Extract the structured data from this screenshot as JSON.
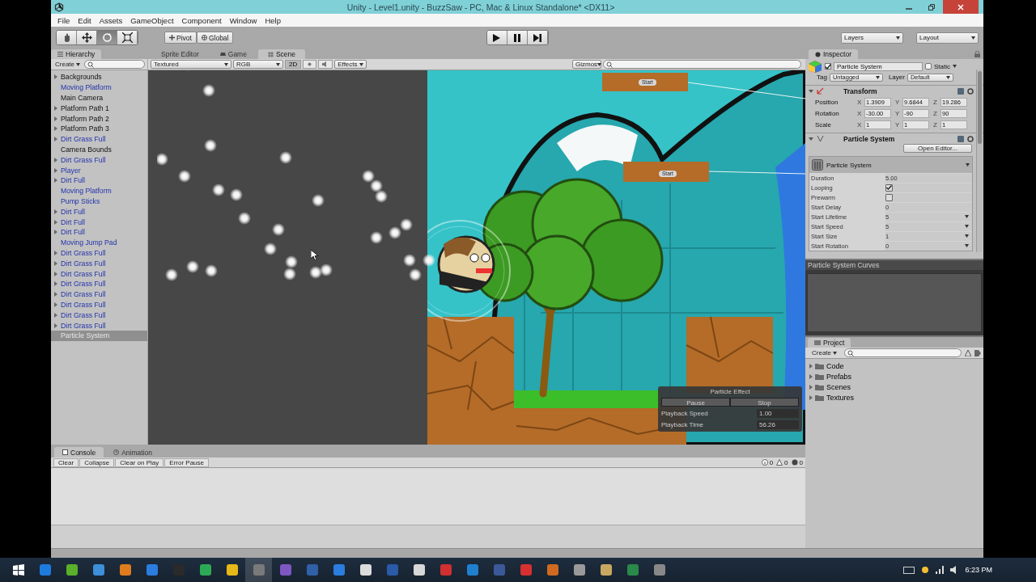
{
  "window": {
    "title": "Unity - Level1.unity - BuzzSaw - PC, Mac & Linux Standalone* <DX11>",
    "menu": [
      "File",
      "Edit",
      "Assets",
      "GameObject",
      "Component",
      "Window",
      "Help"
    ]
  },
  "toolbar": {
    "tools": [
      {
        "kind": "hand",
        "selected": false
      },
      {
        "kind": "move",
        "selected": false
      },
      {
        "kind": "rotate",
        "selected": true
      },
      {
        "kind": "scale",
        "selected": false
      }
    ],
    "pivot": "Pivot",
    "space": "Global",
    "layers": "Layers",
    "layout": "Layout"
  },
  "hierarchy": {
    "tab": "Hierarchy",
    "create": "Create",
    "items": [
      {
        "label": "Backgrounds",
        "expandable": true,
        "prefab": false,
        "selected": false
      },
      {
        "label": "Moving Platform",
        "expandable": false,
        "prefab": true,
        "selected": false
      },
      {
        "label": "Main Camera",
        "expandable": false,
        "prefab": false,
        "selected": false
      },
      {
        "label": "Platform Path 1",
        "expandable": true,
        "prefab": false,
        "selected": false
      },
      {
        "label": "Platform Path 2",
        "expandable": true,
        "prefab": false,
        "selected": false
      },
      {
        "label": "Platform Path 3",
        "expandable": true,
        "prefab": false,
        "selected": false
      },
      {
        "label": "Dirt Grass Full",
        "expandable": true,
        "prefab": true,
        "selected": false
      },
      {
        "label": "Camera Bounds",
        "expandable": false,
        "prefab": false,
        "selected": false
      },
      {
        "label": "Dirt Grass Full",
        "expandable": true,
        "prefab": true,
        "selected": false
      },
      {
        "label": "Player",
        "expandable": true,
        "prefab": true,
        "selected": false
      },
      {
        "label": "Dirt Full",
        "expandable": true,
        "prefab": true,
        "selected": false
      },
      {
        "label": "Moving Platform",
        "expandable": false,
        "prefab": true,
        "selected": false
      },
      {
        "label": "Pump Sticks",
        "expandable": false,
        "prefab": true,
        "selected": false
      },
      {
        "label": "Dirt Full",
        "expandable": true,
        "prefab": true,
        "selected": false
      },
      {
        "label": "Dirt Full",
        "expandable": true,
        "prefab": true,
        "selected": false
      },
      {
        "label": "Dirt Full",
        "expandable": true,
        "prefab": true,
        "selected": false
      },
      {
        "label": "Moving Jump Pad",
        "expandable": false,
        "prefab": true,
        "selected": false
      },
      {
        "label": "Dirt Grass Full",
        "expandable": true,
        "prefab": true,
        "selected": false
      },
      {
        "label": "Dirt Grass Full",
        "expandable": true,
        "prefab": true,
        "selected": false
      },
      {
        "label": "Dirt Grass Full",
        "expandable": true,
        "prefab": true,
        "selected": false
      },
      {
        "label": "Dirt Grass Full",
        "expandable": true,
        "prefab": true,
        "selected": false
      },
      {
        "label": "Dirt Grass Full",
        "expandable": true,
        "prefab": true,
        "selected": false
      },
      {
        "label": "Dirt Grass Full",
        "expandable": true,
        "prefab": true,
        "selected": false
      },
      {
        "label": "Dirt Grass Full",
        "expandable": true,
        "prefab": true,
        "selected": false
      },
      {
        "label": "Dirt Grass Full",
        "expandable": true,
        "prefab": true,
        "selected": false
      },
      {
        "label": "Particle System",
        "expandable": false,
        "prefab": false,
        "selected": true
      }
    ]
  },
  "scene_tabs": [
    {
      "label": "Sprite Editor",
      "selected": false
    },
    {
      "label": "Game",
      "selected": false
    },
    {
      "label": "Scene",
      "selected": true
    }
  ],
  "scene_toolbar": {
    "shading": "Textured",
    "channel": "RGB",
    "mode_2d": {
      "label": "2D",
      "on": true
    },
    "lighting": {
      "on": false
    },
    "audio": {
      "on": false
    },
    "effects": "Effects",
    "gizmos": "Gizmos"
  },
  "scene": {
    "platform_labels": [
      "Start",
      "Start"
    ],
    "particle_effect": {
      "title": "Particle Effect",
      "buttons": [
        "Pause",
        "Stop"
      ],
      "rows": [
        {
          "label": "Playback Speed",
          "value": "1.00"
        },
        {
          "label": "Playback Time",
          "value": "56.26"
        }
      ]
    }
  },
  "console": {
    "tabs": [
      {
        "label": "Console",
        "selected": true
      },
      {
        "label": "Animation",
        "selected": false
      }
    ],
    "buttons": [
      "Clear",
      "Collapse",
      "Clear on Play",
      "Error Pause"
    ],
    "counts": [
      {
        "kind": "info",
        "value": "0"
      },
      {
        "kind": "warning",
        "value": "0"
      },
      {
        "kind": "error",
        "value": "0"
      }
    ]
  },
  "inspector": {
    "tab": "Inspector",
    "object": {
      "active": true,
      "name": "Particle System",
      "static_label": "Static",
      "static": false
    },
    "tag_label": "Tag",
    "tag": "Untagged",
    "layer_label": "Layer",
    "layer": "Default",
    "transform": {
      "title": "Transform",
      "rows": [
        {
          "label": "Position",
          "fields": [
            {
              "axis": "X",
              "value": "1.3909"
            },
            {
              "axis": "Y",
              "value": "9.6844"
            },
            {
              "axis": "Z",
              "value": "19.286"
            }
          ]
        },
        {
          "label": "Rotation",
          "fields": [
            {
              "axis": "X",
              "value": "-30.00"
            },
            {
              "axis": "Y",
              "value": "-90"
            },
            {
              "axis": "Z",
              "value": "90"
            }
          ]
        },
        {
          "label": "Scale",
          "fields": [
            {
              "axis": "X",
              "value": "1"
            },
            {
              "axis": "Y",
              "value": "1"
            },
            {
              "axis": "Z",
              "value": "1"
            }
          ]
        }
      ]
    },
    "particle_system": {
      "title": "Particle System",
      "open_editor": "Open Editor...",
      "module_title": "Particle System",
      "properties": [
        {
          "kind": "value",
          "label": "Duration",
          "value": "5.00",
          "dropdown": false
        },
        {
          "kind": "checkbox",
          "label": "Looping",
          "checked": true
        },
        {
          "kind": "checkbox",
          "label": "Prewarm",
          "checked": false
        },
        {
          "kind": "value",
          "label": "Start Delay",
          "value": "0",
          "dropdown": false
        },
        {
          "kind": "value",
          "label": "Start Lifetime",
          "value": "5",
          "dropdown": true
        },
        {
          "kind": "value",
          "label": "Start Speed",
          "value": "5",
          "dropdown": true
        },
        {
          "kind": "value",
          "label": "Start Size",
          "value": "1",
          "dropdown": true
        },
        {
          "kind": "value",
          "label": "Start Rotation",
          "value": "0",
          "dropdown": true
        }
      ]
    }
  },
  "curves": {
    "title": "Particle System Curves"
  },
  "project": {
    "tab": "Project",
    "create": "Create",
    "folders": [
      "Code",
      "Prefabs",
      "Scenes",
      "Textures"
    ]
  },
  "taskbar": {
    "time": "6:23 PM"
  }
}
